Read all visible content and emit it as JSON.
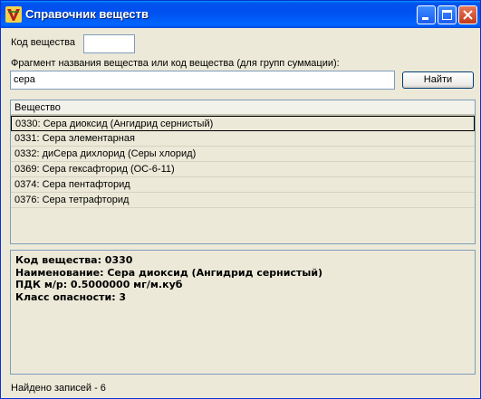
{
  "window": {
    "title": "Справочник веществ",
    "icon": "v-logo-icon",
    "controls": [
      "minimize-icon",
      "maximize-icon",
      "close-icon"
    ]
  },
  "code_field": {
    "label": "Код вещества",
    "value": ""
  },
  "search": {
    "label": "Фрагмент названия вещества или код вещества (для групп суммации):",
    "value": "сера",
    "button_label": "Найти"
  },
  "list": {
    "header": "Вещество",
    "rows": [
      "0330: Сера диоксид (Ангидрид сернистый)",
      "0331: Сера элементарная",
      "0332: диСера дихлорид (Серы хлорид)",
      "0369: Сера гексафторид (ОС-6-11)",
      "0374: Сера пентафторид",
      "0376: Сера тетрафторид"
    ],
    "selected_index": 0
  },
  "details": {
    "line1": "Код вещества: 0330",
    "line2": "Наименование: Сера диоксид (Ангидрид сернистый)",
    "line3": "ПДК м/р: 0.5000000 мг/м.куб",
    "line4": "Класс опасности: 3"
  },
  "status": {
    "text": "Найдено записей - 6"
  },
  "colors": {
    "titlebar": "#0054e3",
    "face": "#ece9d8",
    "border": "#7f9db9"
  }
}
